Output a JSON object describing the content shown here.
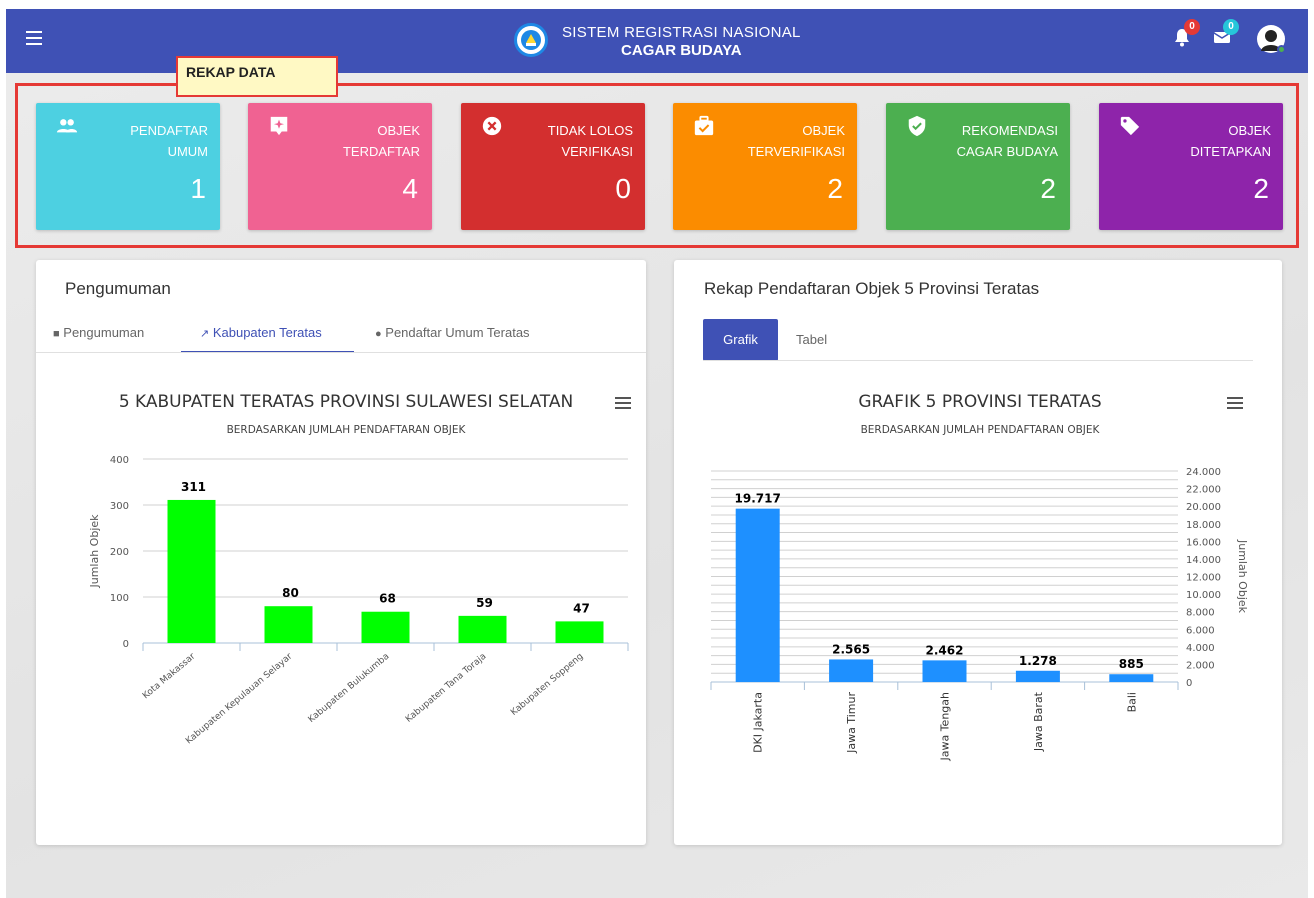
{
  "header": {
    "line1": "SISTEM REGISTRASI NASIONAL",
    "line2": "CAGAR BUDAYA",
    "notif_count": "0",
    "message_count": "0"
  },
  "rekap_label": "REKAP DATA",
  "cards": [
    {
      "line1": "PENDAFTAR",
      "line2": "UMUM",
      "value": "1",
      "color": "#4dd0e1",
      "icon": "people-icon"
    },
    {
      "line1": "OBJEK",
      "line2": "TERDAFTAR",
      "value": "4",
      "color": "#f06292",
      "icon": "sparkle-icon"
    },
    {
      "line1": "TIDAK LOLOS",
      "line2": "VERIFIKASI",
      "value": "0",
      "color": "#d32f2f",
      "icon": "cancel-icon"
    },
    {
      "line1": "OBJEK",
      "line2": "TERVERIFIKASI",
      "value": "2",
      "color": "#fb8c00",
      "icon": "briefcase-check-icon"
    },
    {
      "line1": "REKOMENDASI",
      "line2": "CAGAR BUDAYA",
      "value": "2",
      "color": "#4caf50",
      "icon": "shield-check-icon"
    },
    {
      "line1": "OBJEK",
      "line2": "DITETAPKAN",
      "value": "2",
      "color": "#8e24aa",
      "icon": "tag-icon"
    }
  ],
  "left_panel": {
    "title": "Pengumuman",
    "tabs": [
      "Pengumuman",
      "Kabupaten Teratas",
      "Pendaftar Umum Teratas"
    ],
    "active_tab": 1
  },
  "right_panel": {
    "title": "Rekap Pendaftaran Objek 5 Provinsi Teratas",
    "buttons": [
      "Grafik",
      "Tabel"
    ]
  },
  "chart_data": [
    {
      "type": "bar",
      "title": "5 KABUPATEN TERATAS PROVINSI SULAWESI SELATAN",
      "subtitle": "BERDASARKAN JUMLAH PENDAFTARAN OBJEK",
      "ylabel": "Jumlah Objek",
      "categories": [
        "Kota Makassar",
        "Kabupaten Kepulauan Selayar",
        "Kabupaten Bulukumba",
        "Kabupaten Tana Toraja",
        "Kabupaten Soppeng"
      ],
      "values": [
        311,
        80,
        68,
        59,
        47
      ],
      "data_labels": [
        "311",
        "80",
        "68",
        "59",
        "47"
      ],
      "ylim": [
        0,
        400
      ],
      "yticks": [
        "0",
        "100",
        "200",
        "300",
        "400"
      ],
      "bar_color": "#00ff00"
    },
    {
      "type": "bar",
      "title": "GRAFIK 5 PROVINSI TERATAS",
      "subtitle": "BERDASARKAN JUMLAH PENDAFTARAN OBJEK",
      "ylabel": "Jumlah Objek",
      "categories": [
        "DKI Jakarta",
        "Jawa Timur",
        "Jawa Tengah",
        "Jawa Barat",
        "Bali"
      ],
      "values": [
        19717,
        2565,
        2462,
        1278,
        885
      ],
      "data_labels": [
        "19.717",
        "2.565",
        "2.462",
        "1.278",
        "885"
      ],
      "ylim": [
        0,
        24000
      ],
      "yticks": [
        "0",
        "2.000",
        "4.000",
        "6.000",
        "8.000",
        "10.000",
        "12.000",
        "14.000",
        "16.000",
        "18.000",
        "20.000",
        "22.000",
        "24.000"
      ],
      "bar_color": "#1e90ff"
    }
  ]
}
